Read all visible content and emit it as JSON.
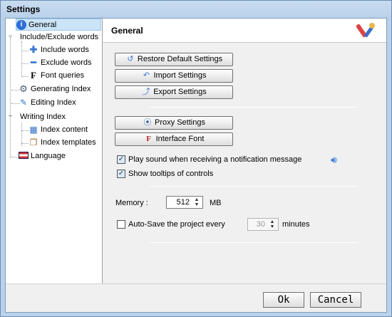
{
  "window": {
    "title": "Settings"
  },
  "tree": {
    "items": [
      {
        "label": "General",
        "icon": "info-icon"
      },
      {
        "label": "Include/Exclude words",
        "icon": ""
      },
      {
        "label": "Include words",
        "icon": "plus-icon"
      },
      {
        "label": "Exclude words",
        "icon": "minus-icon"
      },
      {
        "label": "Font queries",
        "icon": "font-icon"
      },
      {
        "label": "Generating Index",
        "icon": "gear-icon"
      },
      {
        "label": "Editing Index",
        "icon": "pen-icon"
      },
      {
        "label": "Writing Index",
        "icon": ""
      },
      {
        "label": "Index content",
        "icon": "calendar-icon"
      },
      {
        "label": "Index templates",
        "icon": "box-icon"
      },
      {
        "label": "Language",
        "icon": "flag-icon"
      }
    ]
  },
  "content": {
    "title": "General",
    "buttons": {
      "restore": "Restore Default Settings",
      "import": "Import Settings",
      "export": "Export Settings",
      "proxy": "Proxy Settings",
      "interface_font": "Interface Font"
    },
    "checkboxes": {
      "play_sound": "Play sound when receiving a notification message",
      "tooltips": "Show tooltips of controls",
      "autosave": "Auto-Save the project every"
    },
    "memory": {
      "label": "Memory :",
      "value": "512",
      "unit": "MB"
    },
    "autosave": {
      "value": "30",
      "unit": "minutes"
    }
  },
  "footer": {
    "ok": "Ok",
    "cancel": "Cancel"
  }
}
